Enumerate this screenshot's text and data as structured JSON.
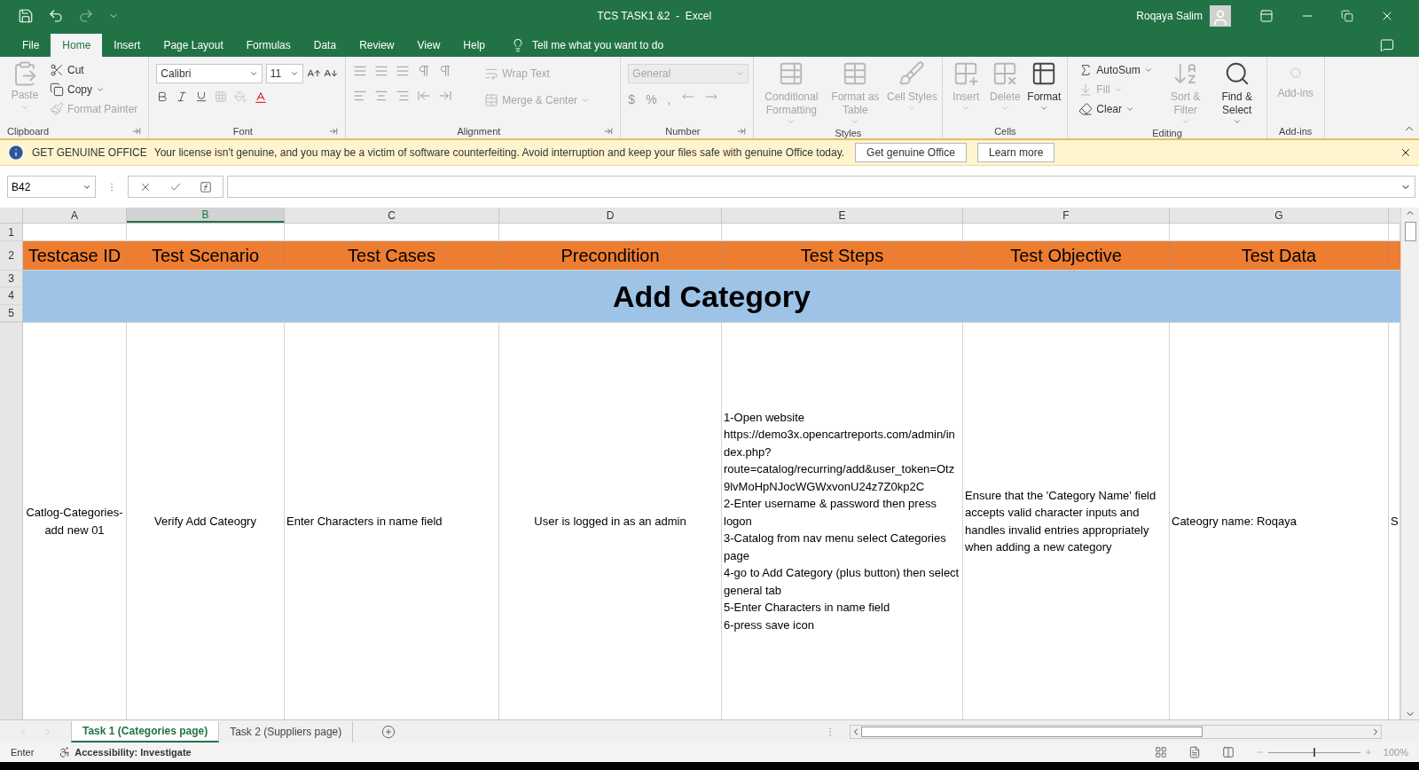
{
  "title_bar": {
    "document": "TCS TASK1 &2  -  Excel",
    "user": "Roqaya Salim"
  },
  "menu_tabs": [
    {
      "label": "File",
      "selected": false
    },
    {
      "label": "Home",
      "selected": true
    },
    {
      "label": "Insert",
      "selected": false
    },
    {
      "label": "Page Layout",
      "selected": false
    },
    {
      "label": "Formulas",
      "selected": false
    },
    {
      "label": "Data",
      "selected": false
    },
    {
      "label": "Review",
      "selected": false
    },
    {
      "label": "View",
      "selected": false
    },
    {
      "label": "Help",
      "selected": false
    }
  ],
  "tell_me": "Tell me what you want to do",
  "ribbon": {
    "clipboard": {
      "label": "Clipboard",
      "paste": {
        "label": "Paste",
        "disabled": true
      },
      "items": [
        {
          "kind": "cut",
          "label": "Cut",
          "disabled": false
        },
        {
          "kind": "copy",
          "label": "Copy",
          "disabled": false
        },
        {
          "kind": "format_painter",
          "label": "Format Painter",
          "disabled": true
        }
      ]
    },
    "font": {
      "label": "Font",
      "font_name": "Calibri",
      "font_size": "11"
    },
    "alignment": {
      "label": "Alignment",
      "items": [
        {
          "kind": "wrap",
          "label": "Wrap Text",
          "disabled": true
        },
        {
          "kind": "merge",
          "label": "Merge & Center",
          "disabled": true
        }
      ]
    },
    "number": {
      "label": "Number",
      "format": {
        "value": "General",
        "disabled": true
      },
      "symbols": [
        "$",
        "%",
        ","
      ]
    },
    "styles": {
      "label": "Styles",
      "items": [
        {
          "kind": "conditional",
          "label": "Conditional Formatting",
          "disabled": true
        },
        {
          "kind": "table",
          "label": "Format as Table",
          "disabled": true
        },
        {
          "kind": "cell_styles",
          "label": "Cell Styles",
          "disabled": true
        }
      ]
    },
    "cells": {
      "label": "Cells",
      "items": [
        {
          "kind": "insert",
          "label": "Insert",
          "disabled": true
        },
        {
          "kind": "delete",
          "label": "Delete",
          "disabled": true
        },
        {
          "kind": "format",
          "label": "Format",
          "disabled": false
        }
      ]
    },
    "editing": {
      "label": "Editing",
      "items": [
        {
          "kind": "autosum",
          "label": "AutoSum",
          "disabled": false
        },
        {
          "kind": "fill",
          "label": "Fill",
          "disabled": true
        },
        {
          "kind": "clear",
          "label": "Clear",
          "disabled": false
        }
      ],
      "big": [
        {
          "kind": "sort",
          "label": "Sort & Filter",
          "disabled": true
        },
        {
          "kind": "find",
          "label": "Find & Select",
          "disabled": false
        }
      ]
    },
    "addins": {
      "label": "Add-ins",
      "items": [
        {
          "label": "Add-ins",
          "disabled": true
        }
      ]
    }
  },
  "banner": {
    "title": "GET GENUINE OFFICE",
    "message": "Your license isn't genuine, and you may be a victim of software counterfeiting. Avoid interruption and keep your files safe with genuine Office today.",
    "buttons": [
      "Get genuine Office",
      "Learn more"
    ]
  },
  "formula_bar": {
    "name_box": "B42"
  },
  "sheet": {
    "columns": [
      {
        "label": "A",
        "selected": false
      },
      {
        "label": "B",
        "selected": true
      },
      {
        "label": "C",
        "selected": false
      },
      {
        "label": "D",
        "selected": false
      },
      {
        "label": "E",
        "selected": false
      },
      {
        "label": "F",
        "selected": false
      },
      {
        "label": "G",
        "selected": false
      }
    ],
    "row_numbers": [
      "1",
      "2",
      "3",
      "4",
      "5"
    ],
    "header_row": [
      "Testcase ID",
      "Test Scenario",
      "Test Cases",
      "Precondition",
      "Test Steps",
      "Test Objective",
      "Test Data"
    ],
    "title_row": "Add Category",
    "data_row": [
      "Catlog-Categories-add new 01",
      "Verify Add Cateogry",
      "Enter Characters in name field",
      "User is logged in as an admin",
      "1-Open website\nhttps://demo3x.opencartreports.com/admin/index.php?route=catalog/recurring/add&user_token=Otz9lvMoHpNJocWGWxvonU24z7Z0kp2C\n2-Enter username & password then press logon\n3-Catalog from nav menu select Categories page\n4-go to Add Category (plus button) then select general tab\n5-Enter Characters in name field\n6-press save icon",
      "Ensure that the 'Category Name' field accepts valid character inputs and handles invalid entries appropriately when adding a new category",
      "Cateogry name: Roqaya",
      "S"
    ]
  },
  "sheet_tabs": [
    {
      "label": "Task 1 (Categories page)",
      "selected": true
    },
    {
      "label": "Task 2 (Suppliers page)",
      "selected": false
    }
  ],
  "status_bar": {
    "mode": "Enter",
    "accessibility": "Accessibility: Investigate",
    "zoom": {
      "level": 0.5,
      "reading": "100%"
    }
  }
}
